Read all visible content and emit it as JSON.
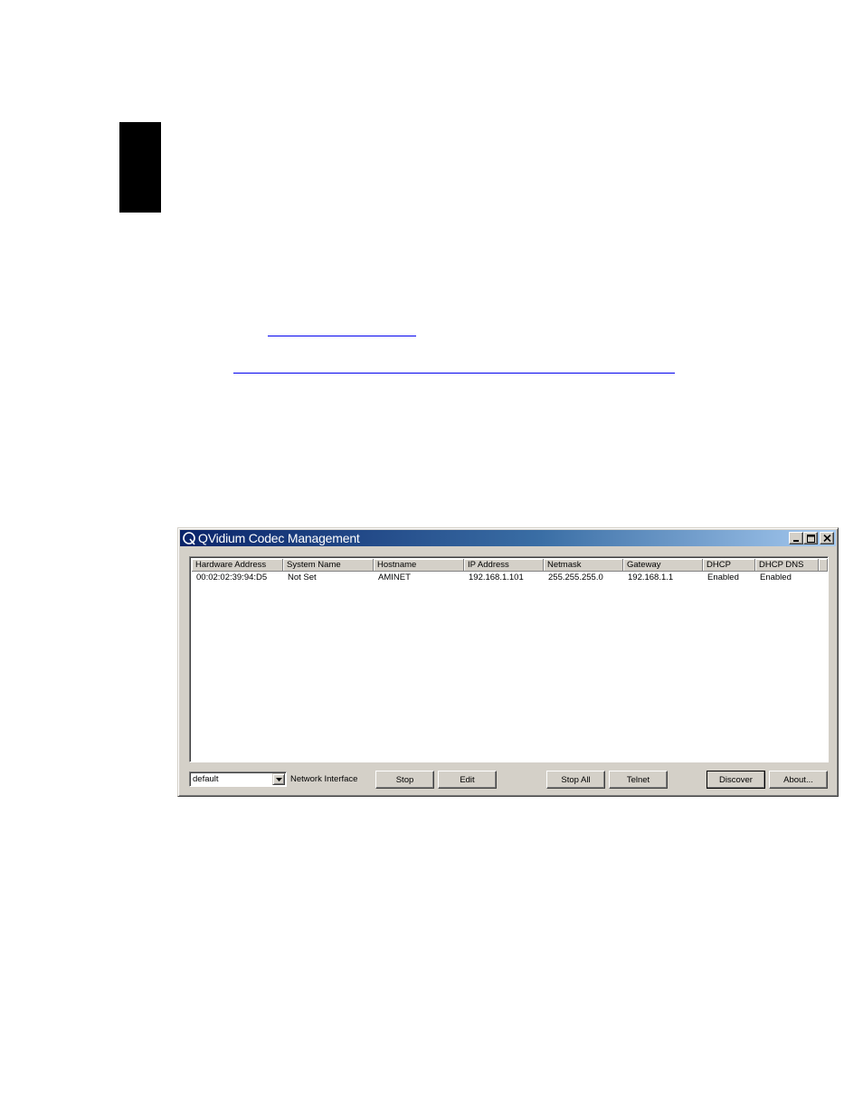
{
  "window": {
    "title": "QVidium Codec Management",
    "buttons": {
      "minimize": "_",
      "maximize": "□",
      "close": "✕"
    }
  },
  "table": {
    "columns": [
      "Hardware Address",
      "System Name",
      "Hostname",
      "IP Address",
      "Netmask",
      "Gateway",
      "DHCP",
      "DHCP DNS"
    ],
    "rows": [
      [
        "00:02:02:39:94:D5",
        "Not Set",
        "AMINET",
        "192.168.1.101",
        "255.255.255.0",
        "192.168.1.1",
        "Enabled",
        "Enabled"
      ]
    ]
  },
  "controls": {
    "interface_value": "default",
    "interface_label": "Network Interface",
    "stop": "Stop",
    "edit": "Edit",
    "stop_all": "Stop All",
    "telnet": "Telnet",
    "discover": "Discover",
    "about": "About..."
  }
}
